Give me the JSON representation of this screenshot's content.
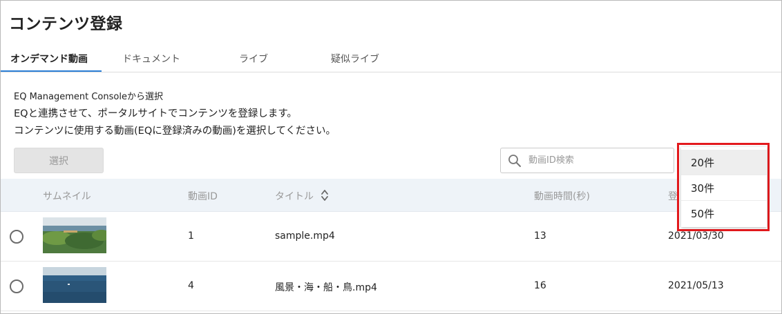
{
  "page": {
    "title": "コンテンツ登録"
  },
  "tabs": [
    {
      "label": "オンデマンド動画",
      "active": true
    },
    {
      "label": "ドキュメント",
      "active": false
    },
    {
      "label": "ライブ",
      "active": false
    },
    {
      "label": "疑似ライブ",
      "active": false
    }
  ],
  "description": {
    "line1": "EQ Management Consoleから選択",
    "line2": "EQと連携させて、ポータルサイトでコンテンツを登録します。",
    "line3": "コンテンツに使用する動画(EQに登録済みの動画)を選択してください。"
  },
  "toolbar": {
    "select_label": "選択",
    "search_placeholder": "動画ID検索"
  },
  "table": {
    "columns": [
      "サムネイル",
      "動画ID",
      "タイトル",
      "動画時間(秒)",
      "登"
    ],
    "rows": [
      {
        "id": "1",
        "title": "sample.mp4",
        "duration": "13",
        "date": "2021/03/30"
      },
      {
        "id": "4",
        "title": "風景・海・船・鳥.mp4",
        "duration": "16",
        "date": "2021/05/13"
      }
    ]
  },
  "page_size_dropdown": {
    "options": [
      "20件",
      "30件",
      "50件"
    ],
    "selected": "20件"
  },
  "colors": {
    "accent": "#2b7fd6",
    "highlight": "#e3191d",
    "header_bg": "#eef3f8"
  }
}
